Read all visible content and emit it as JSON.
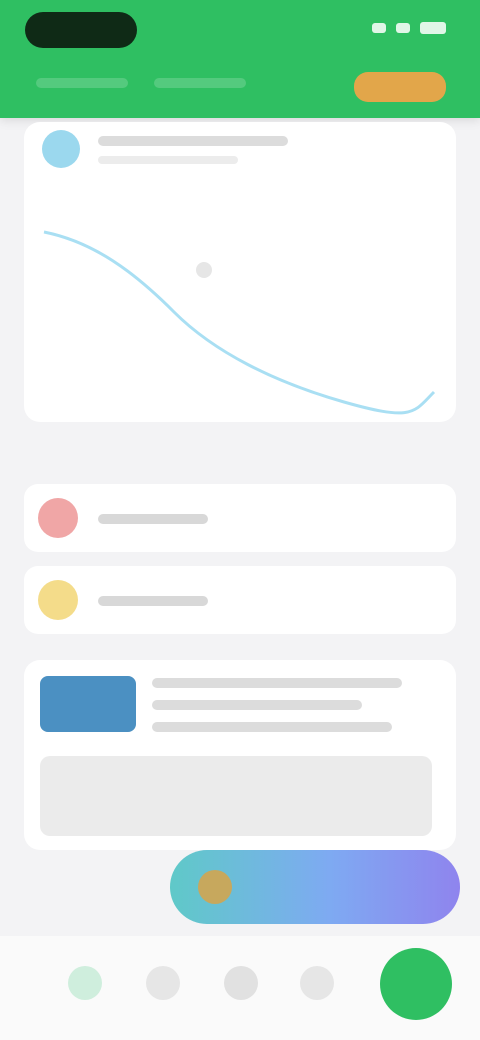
{
  "header": {
    "cta_label": "",
    "tabs": [
      "",
      ""
    ]
  },
  "card": {
    "title": "",
    "subtitle": ""
  },
  "rows": [
    {
      "label": "",
      "color": "#f0a6a6"
    },
    {
      "label": "",
      "color": "#f4dc8a"
    }
  ],
  "article": {
    "title": "",
    "body": ""
  },
  "floating_button": {
    "label": ""
  },
  "colors": {
    "primary": "#2fbf62",
    "accent": "#e2a64a",
    "chart_line": "#a9dff3"
  },
  "icons": {
    "nav": [
      "home-icon",
      "bell-icon",
      "grid-icon",
      "user-icon",
      "add-icon"
    ]
  }
}
